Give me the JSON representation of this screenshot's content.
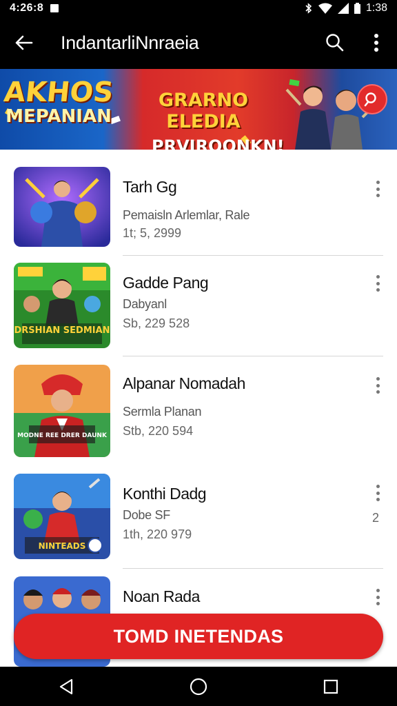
{
  "status_bar": {
    "time": "4:26:8",
    "clock": "1:38",
    "icons": [
      "notification-square-icon",
      "bluetooth-icon",
      "wifi-icon",
      "signal-icon",
      "battery-icon"
    ]
  },
  "app_bar": {
    "title": "IndantarliNnraeia",
    "icons": [
      "back-arrow-icon",
      "search-icon",
      "more-vert-icon"
    ]
  },
  "banner": {
    "left_line1": "AKHOS",
    "left_line2": "MEPANIAN",
    "mid_line1": "GRARNO ELEDIA",
    "mid_line2": "PRVIROONKN!",
    "badge_icon": "search-badge-icon"
  },
  "list": {
    "items": [
      {
        "name": "Tarh Gg",
        "subtitle": "Pemaisln Arlemlar, Rale",
        "meta": "1t; 5, 2999",
        "count": ""
      },
      {
        "name": "Gadde Pang",
        "subtitle": "Dabyanl",
        "meta": "Sb, 229 528",
        "count": ""
      },
      {
        "name": "Alpanar Nomadah",
        "subtitle": "Sermla Planan",
        "meta": "Stb, 220 594",
        "count": ""
      },
      {
        "name": "Konthi Dadg",
        "subtitle": "Dobe SF",
        "meta": "1th, 220 979",
        "count": "2"
      },
      {
        "name": "Noan Rada",
        "subtitle": "",
        "meta": "",
        "count": ""
      }
    ],
    "thumb_texts": [
      "",
      "DRSHIAN SEDMIAN",
      "MODNE REE DRER DAUNK",
      "NINTEADS",
      ""
    ]
  },
  "cta": {
    "label": "TOMD INETENDAS"
  },
  "nav_bar": {
    "icons": [
      "back-triangle-icon",
      "home-circle-icon",
      "recents-square-icon"
    ]
  },
  "colors": {
    "accent": "#e02424",
    "banner_red": "#d62a2a",
    "banner_blue": "#1a66c8",
    "divider": "#d6d6d6"
  }
}
